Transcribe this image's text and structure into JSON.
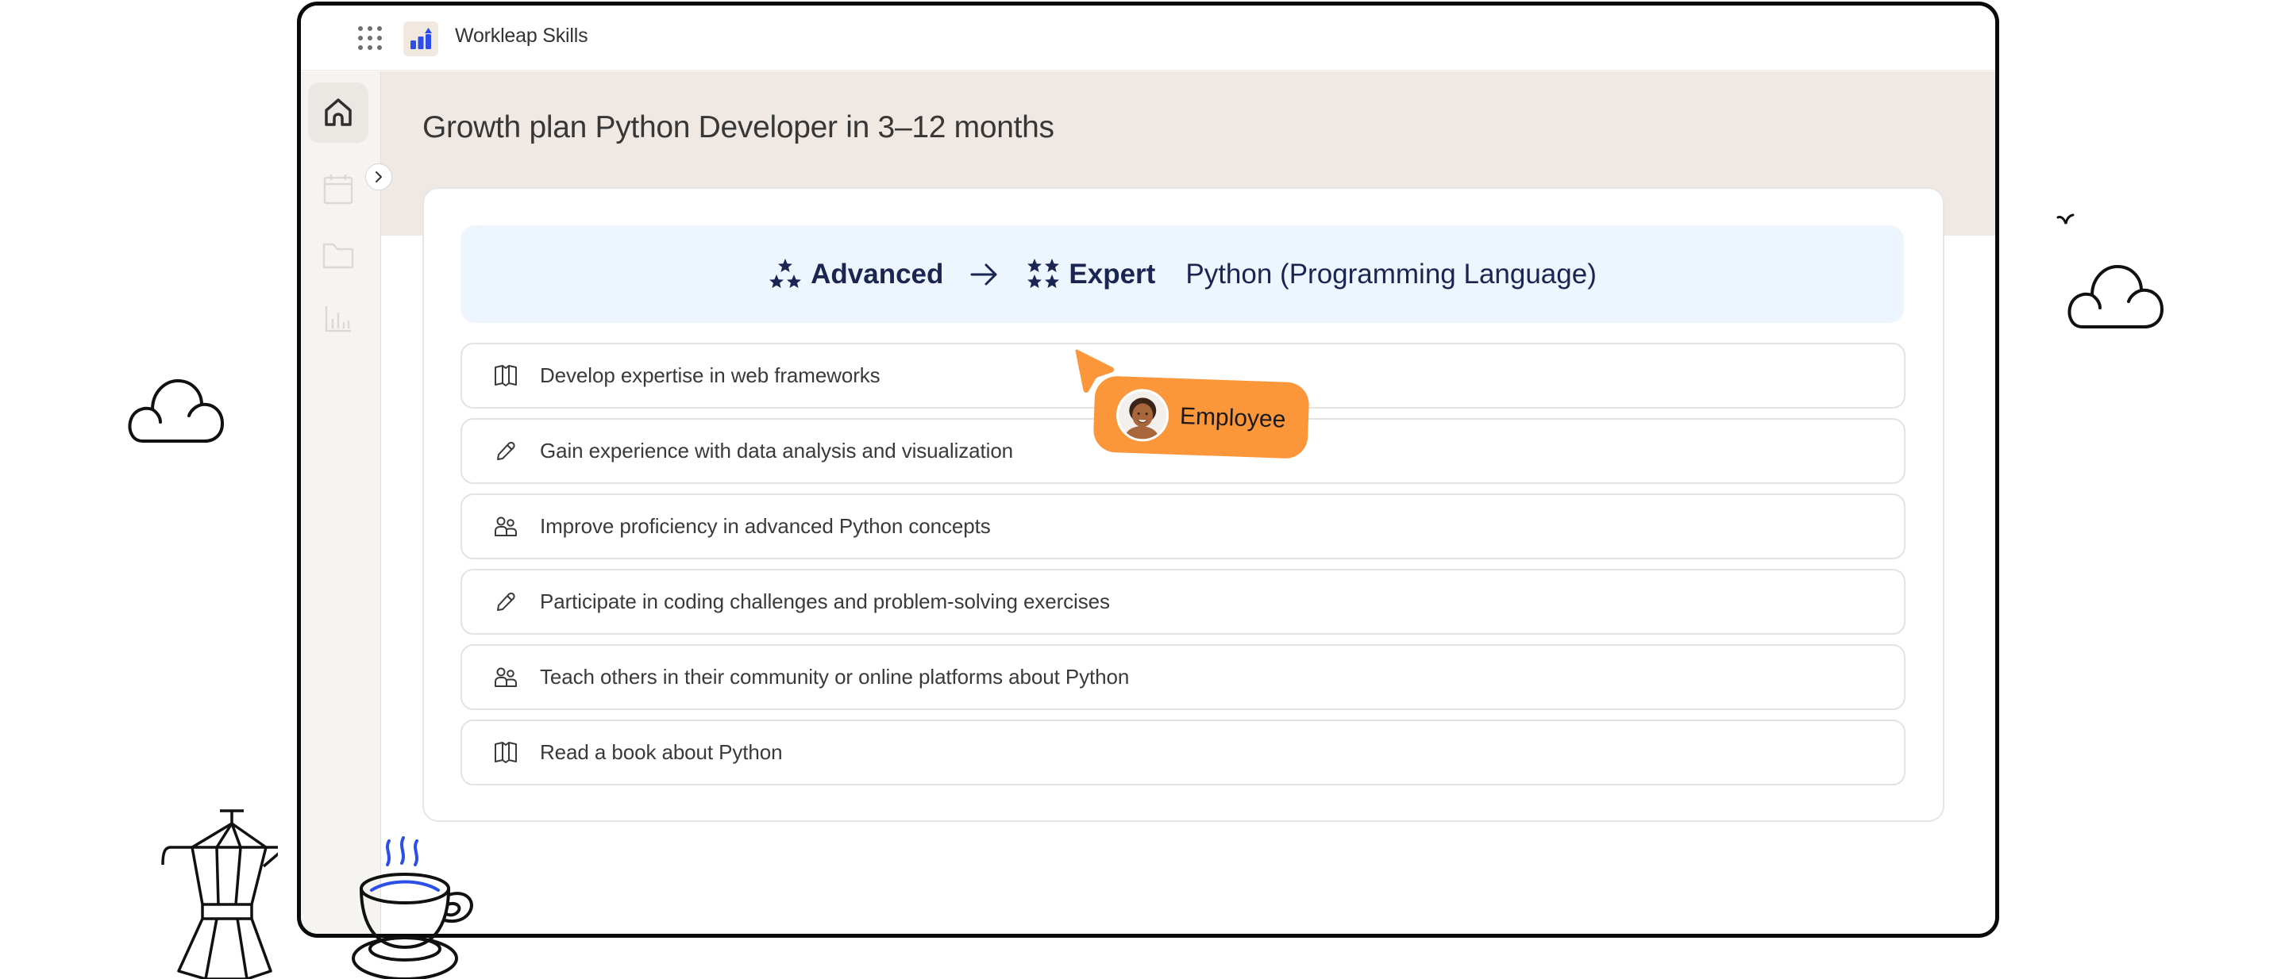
{
  "app": {
    "name": "Workleap Skills",
    "apps_icon": "grid-dots-icon",
    "logo_icon": "bar-chart-up-icon",
    "accent_color": "#2b4fe8"
  },
  "sidebar": {
    "items": [
      {
        "name": "home",
        "icon": "home-icon",
        "active": true
      },
      {
        "name": "calendar",
        "icon": "calendar-icon",
        "active": false
      },
      {
        "name": "folder",
        "icon": "folder-icon",
        "active": false
      },
      {
        "name": "reports",
        "icon": "bar-chart-icon",
        "active": false
      }
    ],
    "expand_icon": "chevron-right-icon"
  },
  "page": {
    "title": "Growth plan Python Developer in 3–12 months"
  },
  "banner": {
    "from_level": "Advanced",
    "from_stars": 3,
    "arrow": "arrow-right-icon",
    "to_level": "Expert",
    "to_stars": 4,
    "skill": "Python (Programming Language)",
    "background_color": "#edf6fe",
    "text_color": "#1a2552"
  },
  "activities": [
    {
      "icon": "book-icon",
      "label": "Develop expertise in web frameworks"
    },
    {
      "icon": "pencil-icon",
      "label": "Gain experience with data analysis and visualization"
    },
    {
      "icon": "users-icon",
      "label": "Improve proficiency in advanced Python concepts"
    },
    {
      "icon": "pencil-icon",
      "label": "Participate in coding challenges and problem-solving exercises"
    },
    {
      "icon": "users-icon",
      "label": "Teach others in their community or online platforms about Python"
    },
    {
      "icon": "book-icon",
      "label": "Read a book about Python"
    }
  ],
  "pointer_tag": {
    "label": "Employee",
    "color": "#fb963a"
  },
  "decorations": [
    "cloud-icon",
    "cloud-icon",
    "bird-icon",
    "moka-pot-icon",
    "coffee-cup-icon"
  ]
}
